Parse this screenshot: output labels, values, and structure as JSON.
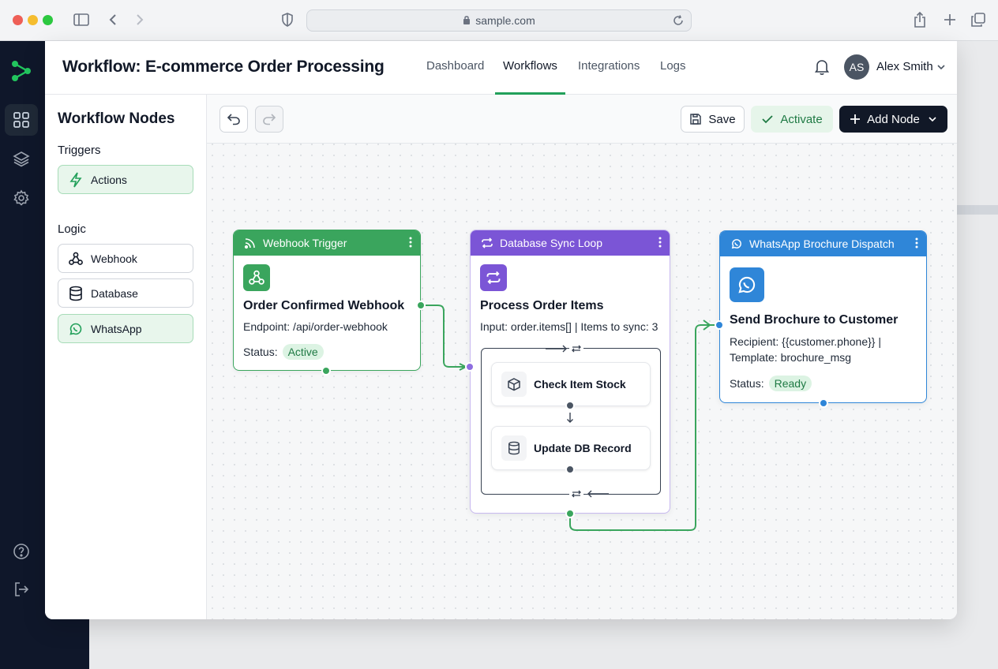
{
  "browser": {
    "url": "sample.com"
  },
  "header": {
    "title": "Workflow: E-commerce Order Processing",
    "tabs": [
      "Dashboard",
      "Workflows",
      "Integrations",
      "Logs"
    ],
    "active_tab": "Workflows",
    "user": {
      "initials": "AS",
      "name": "Alex Smith"
    }
  },
  "sidebar": {
    "title": "Workflow Nodes",
    "triggers_label": "Triggers",
    "trigger_items": [
      {
        "label": "Actions",
        "icon": "lightning-icon"
      }
    ],
    "logic_label": "Logic",
    "logic_items": [
      {
        "label": "Webhook",
        "icon": "webhook-icon"
      },
      {
        "label": "Database",
        "icon": "database-icon"
      },
      {
        "label": "WhatsApp",
        "icon": "whatsapp-icon"
      }
    ]
  },
  "toolbar": {
    "save_label": "Save",
    "activate_label": "Activate",
    "add_node_label": "Add Node"
  },
  "nodes": {
    "webhook": {
      "header": "Webhook Trigger",
      "title": "Order Confirmed Webhook",
      "endpoint": "Endpoint: /api/order-webhook",
      "status_label": "Status:",
      "status": "Active",
      "color": "#3aa55d"
    },
    "loop": {
      "header": "Database Sync Loop",
      "title": "Process Order Items",
      "input": "Input: order.items[] | Items to sync: 3",
      "sub_nodes": [
        "Check Item Stock",
        "Update DB Record"
      ],
      "color": "#7b55d6"
    },
    "whatsapp": {
      "header": "WhatsApp Brochure Dispatch",
      "title": "Send Brochure to Customer",
      "recipient": "Recipient: {{customer.phone}} |",
      "template": "Template: brochure_msg",
      "status_label": "Status:",
      "status": "Ready",
      "color": "#2f86d8"
    }
  },
  "colors": {
    "accent": "#22a05a",
    "rail": "#0f172a"
  }
}
